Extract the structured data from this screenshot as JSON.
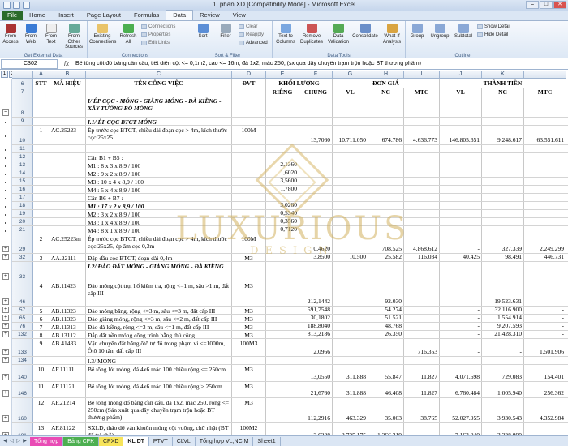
{
  "app": {
    "title": "1. phan XD  [Compatibility Mode]  -  Microsoft Excel"
  },
  "ribbon_tabs": [
    "File",
    "Home",
    "Insert",
    "Page Layout",
    "Formulas",
    "Data",
    "Review",
    "View"
  ],
  "ribbon": {
    "ext": {
      "b1": "From Access",
      "b2": "From Web",
      "b3": "From Text",
      "b4": "From Other Sources",
      "label": "Get External Data"
    },
    "conn": {
      "b1": "Existing Connections",
      "b2": "Refresh All",
      "s1": "Connections",
      "s2": "Properties",
      "s3": "Edit Links",
      "label": "Connections"
    },
    "sort": {
      "b1": "Sort",
      "b2": "Filter",
      "s1": "Clear",
      "s2": "Reapply",
      "s3": "Advanced",
      "label": "Sort & Filter"
    },
    "tools": {
      "b1": "Text to Columns",
      "b2": "Remove Duplicates",
      "b3": "Data Validation",
      "b4": "Consolidate",
      "b5": "What-If Analysis",
      "label": "Data Tools"
    },
    "outline": {
      "b1": "Group",
      "b2": "Ungroup",
      "b3": "Subtotal",
      "s1": "Show Detail",
      "s2": "Hide Detail",
      "label": "Outline"
    }
  },
  "formula_bar": {
    "cell": "C302",
    "fx": "fx",
    "formula": "Bê tông cột đổ bằng cần cẩu, tiết diện cột <= 0,1m2, cao <= 16m, đá 1x2, mác 250, (sx qua dây chuyền trạm trộn hoặc BT thương phẩm)"
  },
  "outline_levels": [
    "1",
    "2",
    "3"
  ],
  "columns": [
    "A",
    "B",
    "C",
    "D",
    "E",
    "F",
    "G",
    "H",
    "I",
    "J",
    "K",
    "L"
  ],
  "header": {
    "stt": "STT",
    "mahieu": "MÃ HIỆU",
    "ten": "TÊN CÔNG VIỆC",
    "dvt": "ĐVT",
    "khoiluong": "KHỐI LƯỢNG",
    "dongia": "ĐƠN GIÁ",
    "thanhtien": "THÀNH TIỀN",
    "rieng": "RIÊNG",
    "chung": "CHUNG",
    "vl": "VL",
    "nc": "NC",
    "mtc": "MTC",
    "vl2": "VL",
    "nc2": "NC",
    "mtc2": "MTC",
    "row_a": "6",
    "row_b": "7"
  },
  "rows": [
    {
      "r": "8",
      "c": [
        "",
        "",
        "I/ ÉP CỌC - MÓNG - GIẰNG MÓNG - ĐÀ KIỀNG - XÂY TƯỜNG BÓ MÓNG",
        "",
        "",
        "",
        "",
        "",
        "",
        "",
        "",
        ""
      ]
    },
    {
      "r": "9",
      "c": [
        "",
        "",
        "I.1/ ÉP CỌC BTCT MÓNG",
        "",
        "",
        "",
        "",
        "",
        "",
        "",
        "",
        ""
      ]
    },
    {
      "r": "10",
      "c": [
        "1",
        "AC.25223",
        "Ép trước cọc BTCT, chiều dài đoạn cọc > 4m, kích thước cọc 25x25",
        "100M",
        "",
        "13,7060",
        "10.711.050",
        "674.786",
        "4.636.773",
        "146.805.651",
        "9.248.617",
        "63.551.611"
      ]
    },
    {
      "r": "11",
      "c": [
        "",
        "",
        "",
        "",
        "",
        "",
        "",
        "",
        "",
        "",
        "",
        ""
      ]
    },
    {
      "r": "12",
      "c": [
        "",
        "",
        "Cân B1 + B5 :",
        "",
        "",
        "",
        "",
        "",
        "",
        "",
        "",
        ""
      ]
    },
    {
      "r": "13",
      "c": [
        "",
        "",
        "M1 : 8 x 3 x 8,9 / 100",
        "",
        "2,1360",
        "",
        "",
        "",
        "",
        "",
        "",
        ""
      ]
    },
    {
      "r": "14",
      "c": [
        "",
        "",
        "M2 : 9 x 2 x 8,9 / 100",
        "",
        "1,6020",
        "",
        "",
        "",
        "",
        "",
        "",
        ""
      ]
    },
    {
      "r": "15",
      "c": [
        "",
        "",
        "M3 : 10 x 4 x 8,9 / 100",
        "",
        "3,5600",
        "",
        "",
        "",
        "",
        "",
        "",
        ""
      ]
    },
    {
      "r": "16",
      "c": [
        "",
        "",
        "M4 : 5 x 4 x 8,9 / 100",
        "",
        "1,7800",
        "",
        "",
        "",
        "",
        "",
        "",
        ""
      ]
    },
    {
      "r": "17",
      "c": [
        "",
        "",
        "Cân B6 + B7 :",
        "",
        "",
        "",
        "",
        "",
        "",
        "",
        "",
        ""
      ]
    },
    {
      "r": "18",
      "c": [
        "",
        "",
        "M1 : 17 x 2 x 8,9 / 100",
        "",
        "3,0260",
        "",
        "",
        "",
        "",
        "",
        "",
        ""
      ]
    },
    {
      "r": "19",
      "c": [
        "",
        "",
        "M2 : 3 x 2 x 8,9 / 100",
        "",
        "0,5340",
        "",
        "",
        "",
        "",
        "",
        "",
        ""
      ]
    },
    {
      "r": "20",
      "c": [
        "",
        "",
        "M3 : 1 x 4 x 8,9 / 100",
        "",
        "0,3560",
        "",
        "",
        "",
        "",
        "",
        "",
        ""
      ]
    },
    {
      "r": "21",
      "c": [
        "",
        "",
        "M4 : 8 x 1 x 8,9 / 100",
        "",
        "0,7120",
        "",
        "",
        "",
        "",
        "",
        "",
        ""
      ]
    },
    {
      "r": "29",
      "c": [
        "2",
        "AC.25223m",
        "Ép trước cọc BTCT, chiều dài đoạn cọc > 4m, kích thước cọc 25x25, ép âm cọc 0,3m",
        "100M",
        "",
        "0,4620",
        "",
        "708.525",
        "4.868.612",
        "-",
        "327.339",
        "2.249.299"
      ]
    },
    {
      "r": "32",
      "c": [
        "3",
        "AA.22111",
        "Đập đầu cọc BTCT, đoạn dài 0,4m",
        "M3",
        "",
        "3,8500",
        "10.500",
        "25.582",
        "116.034",
        "40.425",
        "98.491",
        "446.731"
      ]
    },
    {
      "r": "33",
      "c": [
        "",
        "",
        "I.2/ ĐÀO ĐẤT MÓNG - GIẰNG MÓNG - ĐÀ KIỀNG",
        "",
        "",
        "",
        "",
        "",
        "",
        "",
        "",
        ""
      ]
    },
    {
      "r": "46",
      "c": [
        "4",
        "AB.11423",
        "Đào móng cột trụ, hố kiểm tra, rộng <=1 m, sâu >1 m, đất cấp III",
        "M3",
        "",
        "212,1442",
        "",
        "92.030",
        "",
        "-",
        "19.523.631",
        "-"
      ]
    },
    {
      "r": "57",
      "c": [
        "5",
        "AB.11323",
        "Đào móng băng, rộng <=3 m, sâu <=3 m, đất cấp III",
        "M3",
        "",
        "591,7548",
        "",
        "54.274",
        "",
        "-",
        "32.116.900",
        "-"
      ]
    },
    {
      "r": "65",
      "c": [
        "6",
        "AB.11323",
        "Đào giằng móng, rộng <=3 m, sâu <=2 m, đất cấp III",
        "M3",
        "",
        "30,1802",
        "",
        "51.521",
        "",
        "-",
        "1.554.914",
        "-"
      ]
    },
    {
      "r": "76",
      "c": [
        "7",
        "AB.11313",
        "Đào đà kiềng, rộng <=3 m, sâu <=1 m, đất cấp III",
        "M3",
        "",
        "188,8040",
        "",
        "48.768",
        "",
        "-",
        "9.207.593",
        "-"
      ]
    },
    {
      "r": "132",
      "c": [
        "8",
        "AB.13112",
        "Đắp đất nền móng công trình bằng thủ công",
        "M3",
        "",
        "813,2186",
        "",
        "26.350",
        "",
        "-",
        "21.428.310",
        "-"
      ]
    },
    {
      "r": "133",
      "c": [
        "9",
        "AB.41433",
        "Vận chuyển đất bằng ôtô tự đổ trong phạm vi <=1000m, Ôtô 10 tấn, đất cấp III",
        "100M3",
        "",
        "2,0966",
        "",
        "",
        "716.353",
        "-",
        "-",
        "1.501.906"
      ]
    },
    {
      "r": "134",
      "c": [
        "",
        "",
        "I.3/ MÓNG",
        "",
        "",
        "",
        "",
        "",
        "",
        "",
        "",
        ""
      ]
    },
    {
      "r": "140",
      "c": [
        "10",
        "AF.11111",
        "Bê tông lót móng, đá 4x6 mác 100 chiều rộng <= 250cm",
        "M3",
        "",
        "13,0550",
        "311.888",
        "55.847",
        "11.827",
        "4.071.698",
        "729.083",
        "154.401"
      ]
    },
    {
      "r": "146",
      "c": [
        "11",
        "AF.11121",
        "Bê tông lót móng, đá 4x6 mác 100 chiều rộng > 250cm",
        "M3",
        "",
        "21,6760",
        "311.888",
        "46.408",
        "11.827",
        "6.760.484",
        "1.005.940",
        "256.362"
      ]
    },
    {
      "r": "160",
      "c": [
        "12",
        "AF.21214",
        "Bê tông móng đổ bằng cần cẩu, đá 1x2, mác 250, rộng <= 250cm (Sản xuất qua dây chuyền trạm trộn hoặc BT thương phẩm)",
        "M3",
        "",
        "112,2916",
        "463.329",
        "35.003",
        "38.765",
        "52.027.955",
        "3.930.543",
        "4.352.984"
      ]
    },
    {
      "r": "181",
      "c": [
        "13",
        "AF.81122",
        "SXLD, tháo dỡ ván khuôn móng cột vuông, chữ nhật (BT đổ tại chỗ)",
        "100M2",
        "",
        "2,6288",
        "2.725.175",
        "1.266.319",
        "",
        "7.163.940",
        "3.328.899",
        ""
      ]
    }
  ],
  "sheet_tabs": [
    "Tổng hợp",
    "Bảng CPK",
    "CPXD",
    "KL DT",
    "PTVT",
    "CLVL",
    "Tổng hợp VL,NC,M",
    "Sheet1"
  ],
  "watermark": {
    "text": "LUXURIOUS",
    "sub": "DESIGN"
  },
  "colors": {
    "tab_green": "#2a6b2a",
    "tab_pink": "#e94bb5",
    "tab_header": "#dbe6f4"
  }
}
